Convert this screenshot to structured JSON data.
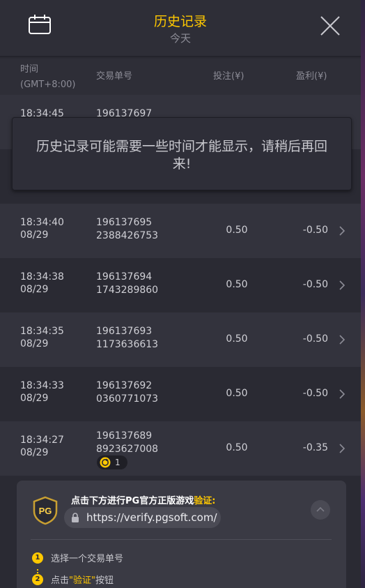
{
  "header": {
    "title": "历史记录",
    "subtitle": "今天",
    "calendar_icon": "calendar-icon",
    "close_icon": "close-icon"
  },
  "columns": {
    "time": "时间",
    "timezone": "(GMT+8:00)",
    "txn": "交易单号",
    "bet": "投注(¥)",
    "profit": "盈利(¥)"
  },
  "notice": {
    "text": "历史记录可能需要一些时间才能显示，请稍后再回来!"
  },
  "rows": [
    {
      "time": "18:34:45",
      "date": "",
      "txn1": "196137697",
      "txn2": "",
      "bet": "",
      "profit": ""
    },
    {
      "time": "18:34:40",
      "date": "08/29",
      "txn1": "196137695",
      "txn2": "2388426753",
      "bet": "0.50",
      "profit": "-0.50"
    },
    {
      "time": "18:34:38",
      "date": "08/29",
      "txn1": "196137694",
      "txn2": "1743289860",
      "bet": "0.50",
      "profit": "-0.50"
    },
    {
      "time": "18:34:35",
      "date": "08/29",
      "txn1": "196137693",
      "txn2": "1173636613",
      "bet": "0.50",
      "profit": "-0.50"
    },
    {
      "time": "18:34:33",
      "date": "08/29",
      "txn1": "196137692",
      "txn2": "0360771073",
      "bet": "0.50",
      "profit": "-0.50"
    },
    {
      "time": "18:34:27",
      "date": "08/29",
      "txn1": "196137689",
      "txn2": "8923627008",
      "bet": "0.50",
      "profit": "-0.35",
      "badge": "1"
    }
  ],
  "verify": {
    "title_prefix": "点击下方进行PG官方正版游戏",
    "title_highlight": "验证",
    "title_suffix": ":",
    "logo_text": "PG",
    "url": "https://verify.pgsoft.com/",
    "step1_num": "1",
    "step1": "选择一个交易单号",
    "step2_num": "2",
    "step2_prefix": "点击",
    "step2_highlight": "\"验证\"",
    "step2_suffix": "按钮"
  },
  "colors": {
    "accent": "#ffc800",
    "background": "#2a2a33",
    "row_alt": "#33333d"
  }
}
